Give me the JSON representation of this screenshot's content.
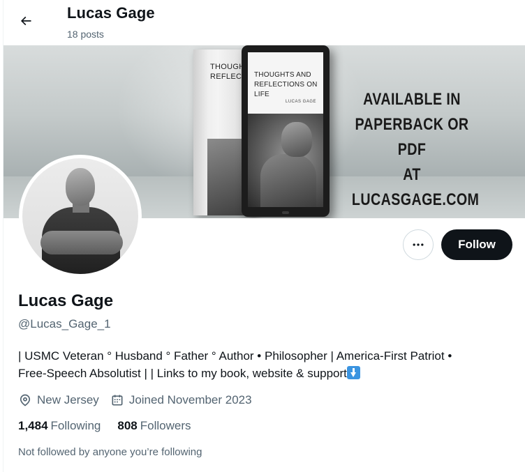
{
  "header": {
    "name": "Lucas Gage",
    "posts": "18 posts",
    "back_icon": "arrow-left-icon"
  },
  "banner": {
    "book_title": "THOUGHTS\nREFLECTIO",
    "tablet_title": "THOUGHTS AND\nREFLECTIONS ON LIFE",
    "tablet_author": "LUCAS GAGE",
    "text_lines": [
      "AVAILABLE IN",
      "PAPERBACK OR PDF",
      "AT LUCASGAGE.COM"
    ]
  },
  "actions": {
    "more_icon": "more-horizontal-icon",
    "follow_label": "Follow"
  },
  "profile": {
    "display_name": "Lucas Gage",
    "handle": "@Lucas_Gage_1",
    "bio_line1": "| USMC Veteran ° Husband ° Father ° Author • Philosopher | America-First Patriot •",
    "bio_line2": "Free-Speech Absolutist |  | Links to my book, website & support",
    "bio_emoji": "down-arrow-emoji",
    "location": "New Jersey",
    "location_icon": "location-pin-icon",
    "joined": "Joined November 2023",
    "joined_icon": "calendar-icon"
  },
  "stats": {
    "following_count": "1,484",
    "following_label": "Following",
    "followers_count": "808",
    "followers_label": "Followers"
  },
  "footer": {
    "not_followed": "Not followed by anyone you’re following"
  },
  "colors": {
    "text_primary": "#0f1419",
    "text_secondary": "#536471",
    "follow_bg": "#0f1419",
    "border": "#cfd9de"
  }
}
